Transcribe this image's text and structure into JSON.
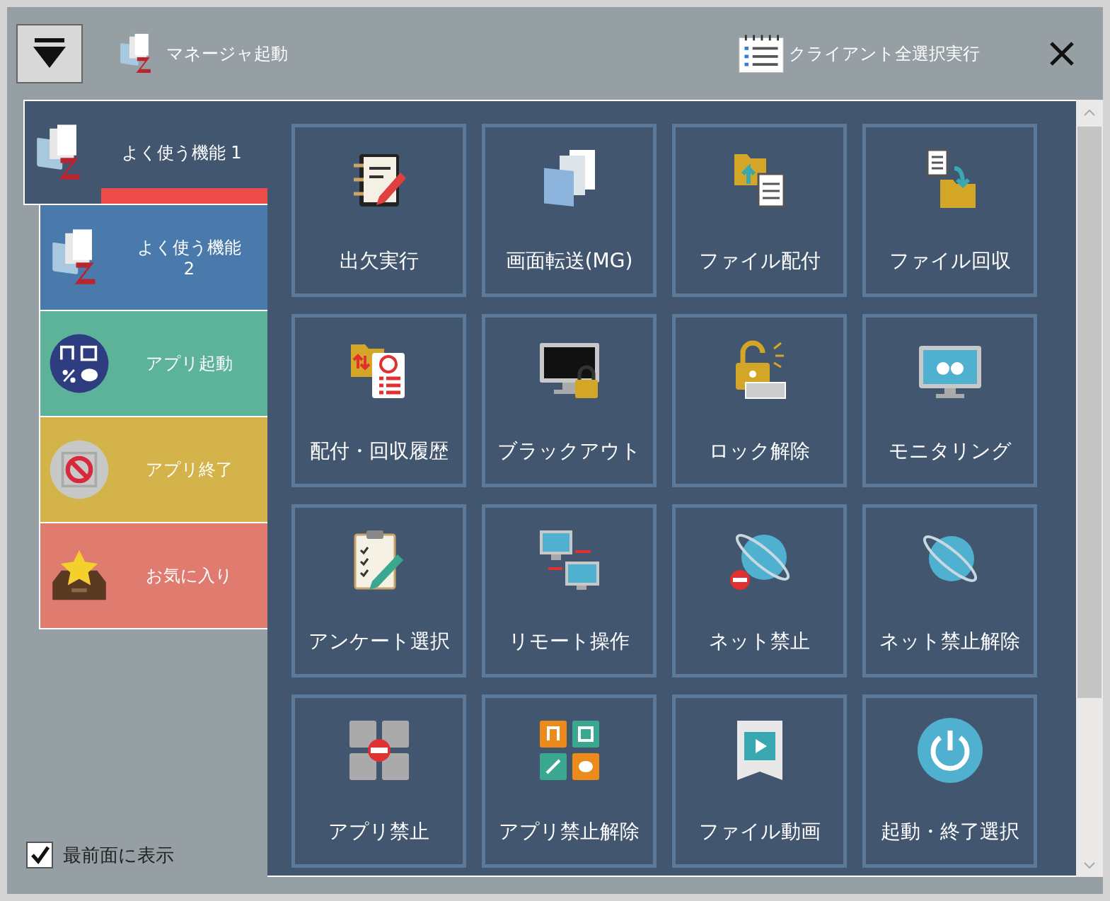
{
  "toolbar": {
    "manager_button": "マネージャ起動",
    "select_all_button": "クライアント全選択実行"
  },
  "categories": [
    {
      "label": "よく使う機能 1",
      "selected": true,
      "color": "#435670"
    },
    {
      "label": "よく使う機能 2",
      "selected": false,
      "color": "#4a7aab"
    },
    {
      "label": "アプリ起動",
      "selected": false,
      "color": "#5cb39a"
    },
    {
      "label": "アプリ終了",
      "selected": false,
      "color": "#d4b44a"
    },
    {
      "label": "お気に入り",
      "selected": false,
      "color": "#e07b70"
    }
  ],
  "functions": [
    {
      "label": "出欠実行"
    },
    {
      "label": "画面転送(MG)"
    },
    {
      "label": "ファイル配付"
    },
    {
      "label": "ファイル回収"
    },
    {
      "label": "配付・回収履歴"
    },
    {
      "label": "ブラックアウト"
    },
    {
      "label": "ロック解除"
    },
    {
      "label": "モニタリング"
    },
    {
      "label": "アンケート選択"
    },
    {
      "label": "リモート操作"
    },
    {
      "label": "ネット禁止"
    },
    {
      "label": "ネット禁止解除"
    },
    {
      "label": "アプリ禁止"
    },
    {
      "label": "アプリ禁止解除"
    },
    {
      "label": "ファイル動画"
    },
    {
      "label": "起動・終了選択"
    }
  ],
  "always_on_top": {
    "label": "最前面に表示",
    "checked": true
  }
}
